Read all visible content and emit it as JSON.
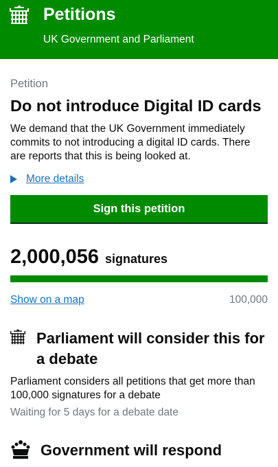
{
  "header": {
    "brand": "Petitions",
    "subtitle": "UK Government and Parliament",
    "logo_icon": "portcullis-icon",
    "bg_color": "#008a00"
  },
  "petition": {
    "kicker": "Petition",
    "title": "Do not introduce Digital ID cards",
    "description": "We demand that the UK Government immediately commits to not introducing a digital ID cards. There are reports that this is being looked at.",
    "more_details": "More details",
    "sign_button": "Sign this petition"
  },
  "signatures": {
    "count": "2,000,056",
    "label": "signatures",
    "show_map": "Show on a map",
    "target": "100,000",
    "progress_fraction": 1.0
  },
  "debate": {
    "icon": "portcullis-icon",
    "title": "Parliament will consider this for a debate",
    "text": "Parliament considers all petitions that get more than 100,000 signatures for a debate",
    "status": "Waiting for 5 days for a debate date"
  },
  "government": {
    "icon": "crown-icon",
    "title": "Government will respond"
  }
}
